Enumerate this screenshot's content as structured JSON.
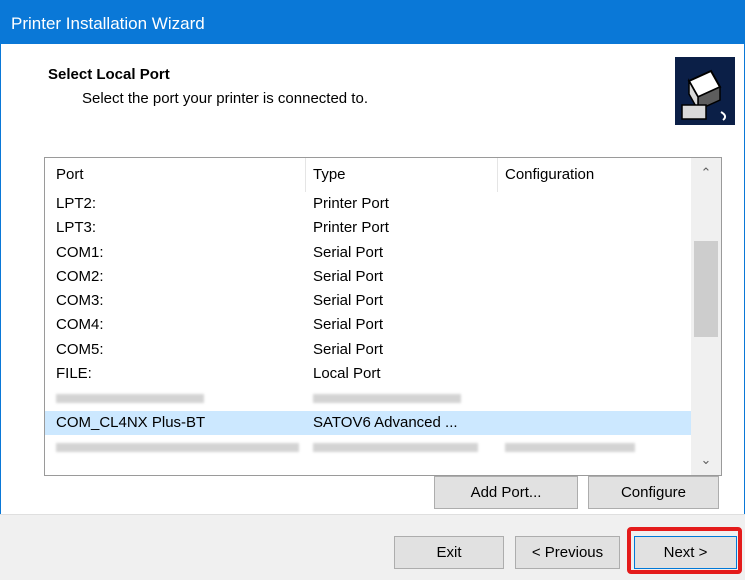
{
  "window": {
    "title": "Printer Installation Wizard"
  },
  "header": {
    "heading": "Select Local Port",
    "subheading": "Select the port your printer is connected to.",
    "icon": "printer-wizard-icon"
  },
  "port_list": {
    "columns": [
      "Port",
      "Type",
      "Configuration"
    ],
    "rows": [
      {
        "port": "LPT2:",
        "type": "Printer Port",
        "configuration": ""
      },
      {
        "port": "LPT3:",
        "type": "Printer Port",
        "configuration": ""
      },
      {
        "port": "COM1:",
        "type": "Serial Port",
        "configuration": ""
      },
      {
        "port": "COM2:",
        "type": "Serial Port",
        "configuration": ""
      },
      {
        "port": "COM3:",
        "type": "Serial Port",
        "configuration": ""
      },
      {
        "port": "COM4:",
        "type": "Serial Port",
        "configuration": ""
      },
      {
        "port": "COM5:",
        "type": "Serial Port",
        "configuration": ""
      },
      {
        "port": "FILE:",
        "type": "Local Port",
        "configuration": ""
      },
      {
        "port": "",
        "type": "",
        "configuration": "",
        "redacted": true
      },
      {
        "port": "COM_CL4NX Plus-BT",
        "type": "SATOV6 Advanced ...",
        "configuration": "",
        "selected": true
      },
      {
        "port": "",
        "type": "",
        "configuration": "",
        "redacted": true
      }
    ]
  },
  "buttons": {
    "add_port": "Add Port...",
    "configure": "Configure",
    "exit": "Exit",
    "previous": "< Previous",
    "next": "Next >"
  },
  "colors": {
    "titlebar": "#0a78d7",
    "selection": "#cce8ff",
    "highlight": "#e41b1b"
  }
}
